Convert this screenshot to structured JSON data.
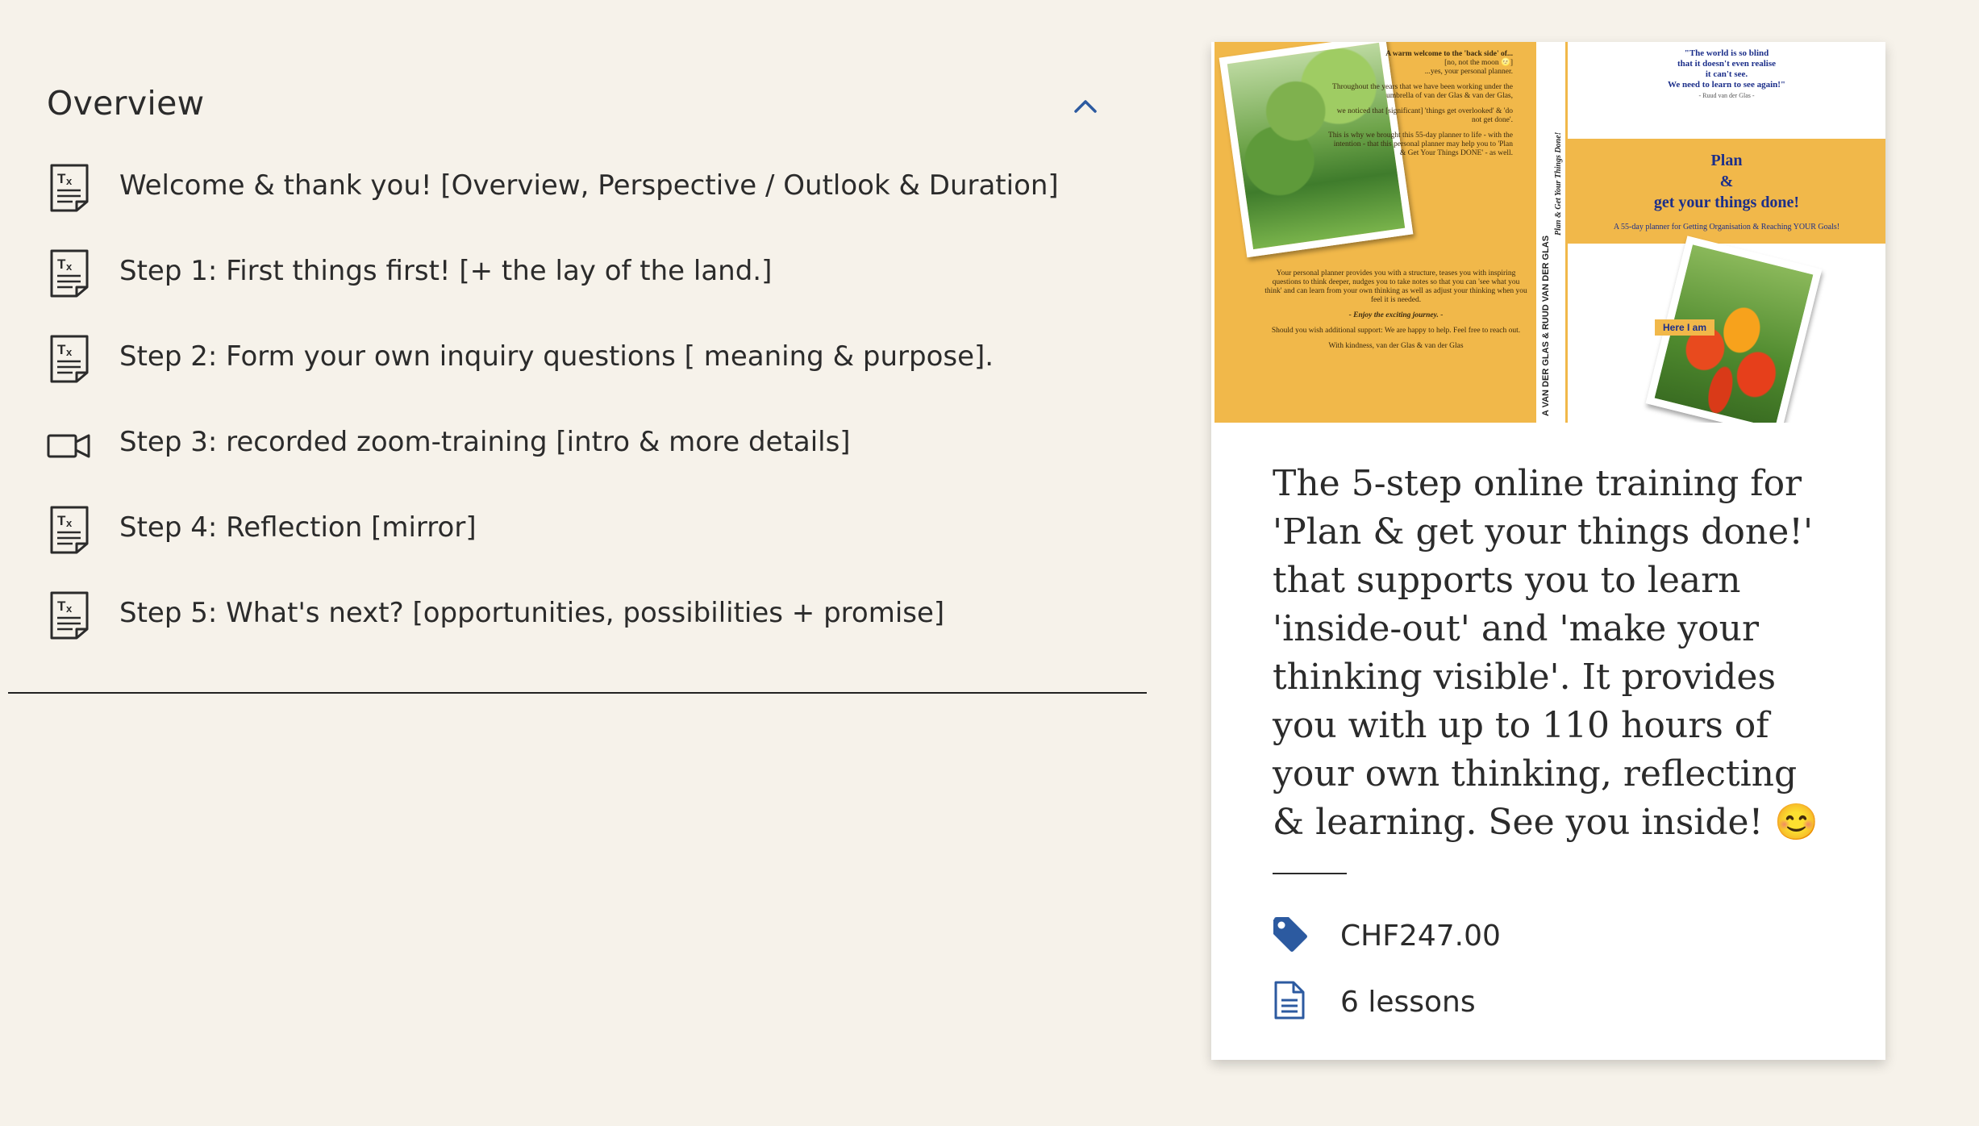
{
  "overview": {
    "title": "Overview",
    "lessons": [
      {
        "label": "Welcome & thank you! [Overview, Perspective / Outlook & Duration]",
        "icon": "text-document-icon"
      },
      {
        "label": "Step 1: First things first! [+ the lay of the land.]",
        "icon": "text-document-icon"
      },
      {
        "label": "Step 2: Form your own inquiry questions [ meaning & purpose].",
        "icon": "text-document-icon"
      },
      {
        "label": "Step 3: recorded zoom-training [intro & more details]",
        "icon": "video-camera-icon"
      },
      {
        "label": "Step 4: Reflection [mirror]",
        "icon": "text-document-icon"
      },
      {
        "label": "Step 5: What's next? [opportunities, possibilities + promise]",
        "icon": "text-document-icon"
      }
    ]
  },
  "course": {
    "cover": {
      "back_intro_1": "A warm welcome to the 'back side' of...",
      "back_intro_2": "[no, not the moon 🌝]",
      "back_intro_3": "...yes, your personal planner.",
      "back_para_1": "Throughout the years that we have been working under the umbrella of van der Glas & van der Glas,",
      "back_para_2": "we noticed that [significant] 'things get overlooked' & 'do not get done'.",
      "back_para_3": "This is why we brought this 55-day planner to life - with the intention - that this personal planner may help you to 'Plan & Get Your Things DONE' - as well.",
      "back_para_4": "Your personal planner provides you with a structure, teases you with inspiring questions to think deeper, nudges you to take notes so that you can 'see what you think' and can learn from your own thinking as well as adjust your thinking when you feel it is needed.",
      "back_para_5": "- Enjoy the exciting journey. -",
      "back_para_6": "Should you wish additional support: We are happy to help. Feel free to reach out.",
      "back_para_7": "With kindness, van der Glas & van der Glas",
      "spine_authors": "A VAN DER GLAS & RUUD VAN DER GLAS",
      "spine_title": "Plan & Get Your Things Done!",
      "quote_line_1": "\"The world is so blind",
      "quote_line_2": "that it doesn't even realise",
      "quote_line_3": "it can't see.",
      "quote_line_4": "We need to learn to see again!\"",
      "quote_author": "- Ruud van der Glas -",
      "front_title_1": "Plan",
      "front_title_2": "&",
      "front_title_3": "get your things done!",
      "front_subtitle": "A 55-day planner for Getting Organisation & Reaching YOUR Goals!",
      "here_tag": "Here I am"
    },
    "description": "The 5-step online training for 'Plan & get your things done!' that supports you to learn 'inside-out' and 'make your thinking visible'. It provides you with up to 110 hours of your own thinking, reflecting & learning. See you inside! 😊",
    "price": "CHF247.00",
    "lessons_count": "6 lessons",
    "icons": {
      "price": "price-tag-icon",
      "lessons": "document-icon"
    },
    "accent_color": "#2c5aa0"
  }
}
